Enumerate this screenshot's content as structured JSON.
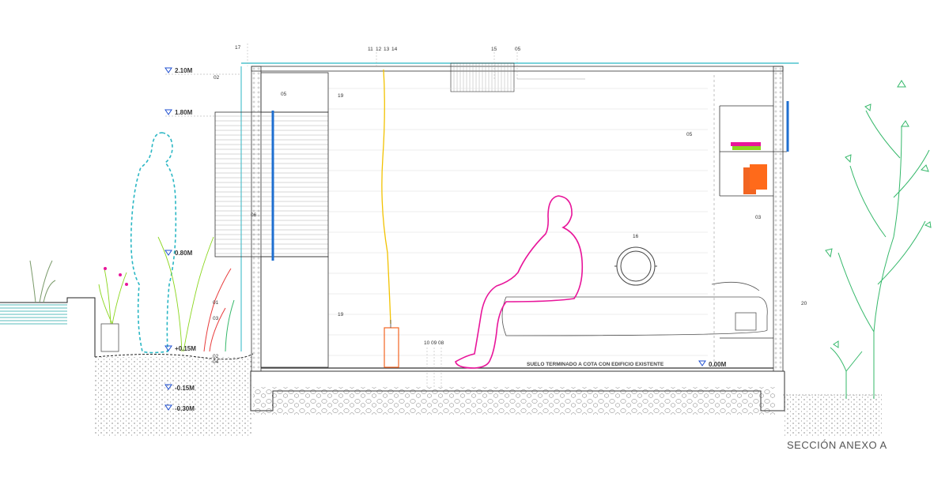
{
  "caption": "SECCIÓN ANEXO A",
  "floor_note": "SUELO TERMINADO A COTA CON EDIFICIO EXISTENTE",
  "levels": {
    "l210": "2.10M",
    "l180": "1.80M",
    "l080": "0.80M",
    "l015": "+0.15M",
    "l000": "0.00M",
    "lm015": "-0.15M",
    "lm030": "-0.30M"
  },
  "callouts": {
    "c17": "17",
    "c02a": "02",
    "c05a": "05",
    "c19a": "19",
    "c06": "06",
    "c01": "01",
    "c03a": "03",
    "c19b": "19",
    "c02b": "02",
    "c04": "04",
    "c11": "11",
    "c12": "12",
    "c13": "13",
    "c14": "14",
    "c15": "15",
    "c05b": "05",
    "c05c": "05",
    "c03b": "03",
    "c16": "16",
    "c20": "20",
    "c10": "10",
    "c09": "09",
    "c08": "08"
  },
  "colors": {
    "line": "#333333",
    "cyan": "#2bb7c4",
    "magenta": "#e8159a",
    "green": "#35b86a",
    "yellow": "#f2c200",
    "blue": "#1f6fd0",
    "orange": "#f26522",
    "level_marker": "#1f4fd0"
  }
}
